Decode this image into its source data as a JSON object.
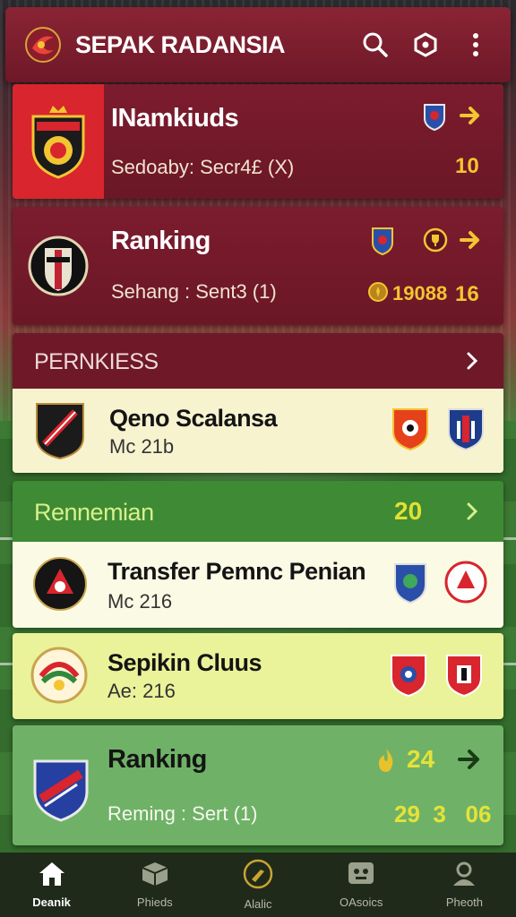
{
  "header": {
    "title": "SEPAK RADANSIA",
    "icons": [
      "logo-icon",
      "search-icon",
      "chat-icon",
      "more-vertical-icon"
    ]
  },
  "cards": {
    "featured1": {
      "title": "INamkiuds",
      "subtitle": "Sedoaby: Secr4£ (X)",
      "score": "10"
    },
    "featured2": {
      "title": "Ranking",
      "subtitle": "Sehang : Sent3 (1)",
      "count": "19088",
      "score": "16"
    },
    "section1": {
      "title": "PERNKIESS"
    },
    "match1": {
      "title": "Qeno Scalansa",
      "subtitle": "Mc 21b"
    },
    "section2": {
      "title": "Rennemian",
      "score": "20"
    },
    "match2": {
      "title": "Transfer Pemnc Penian",
      "subtitle": "Mc 216"
    },
    "match3": {
      "title": "Sepikin Cluus",
      "subtitle": "Ae: 216"
    },
    "ranking": {
      "title": "Ranking",
      "subtitle": "Reming : Sert (1)",
      "score": "24",
      "stats": "29  3   06"
    }
  },
  "nav": {
    "items": [
      {
        "label": "Deanik",
        "icon": "home-icon"
      },
      {
        "label": "Phieds",
        "icon": "box-icon"
      },
      {
        "label": "Alalic",
        "icon": "whistle-icon"
      },
      {
        "label": "OAsoics",
        "icon": "board-icon"
      },
      {
        "label": "Pheoth",
        "icon": "profile-icon"
      }
    ],
    "active": 0
  },
  "colors": {
    "maroon": "#7c1c2e",
    "gold": "#f3c531",
    "cream": "#f8f3cf",
    "green": "#3f8a34",
    "lime": "#eaf39a"
  }
}
